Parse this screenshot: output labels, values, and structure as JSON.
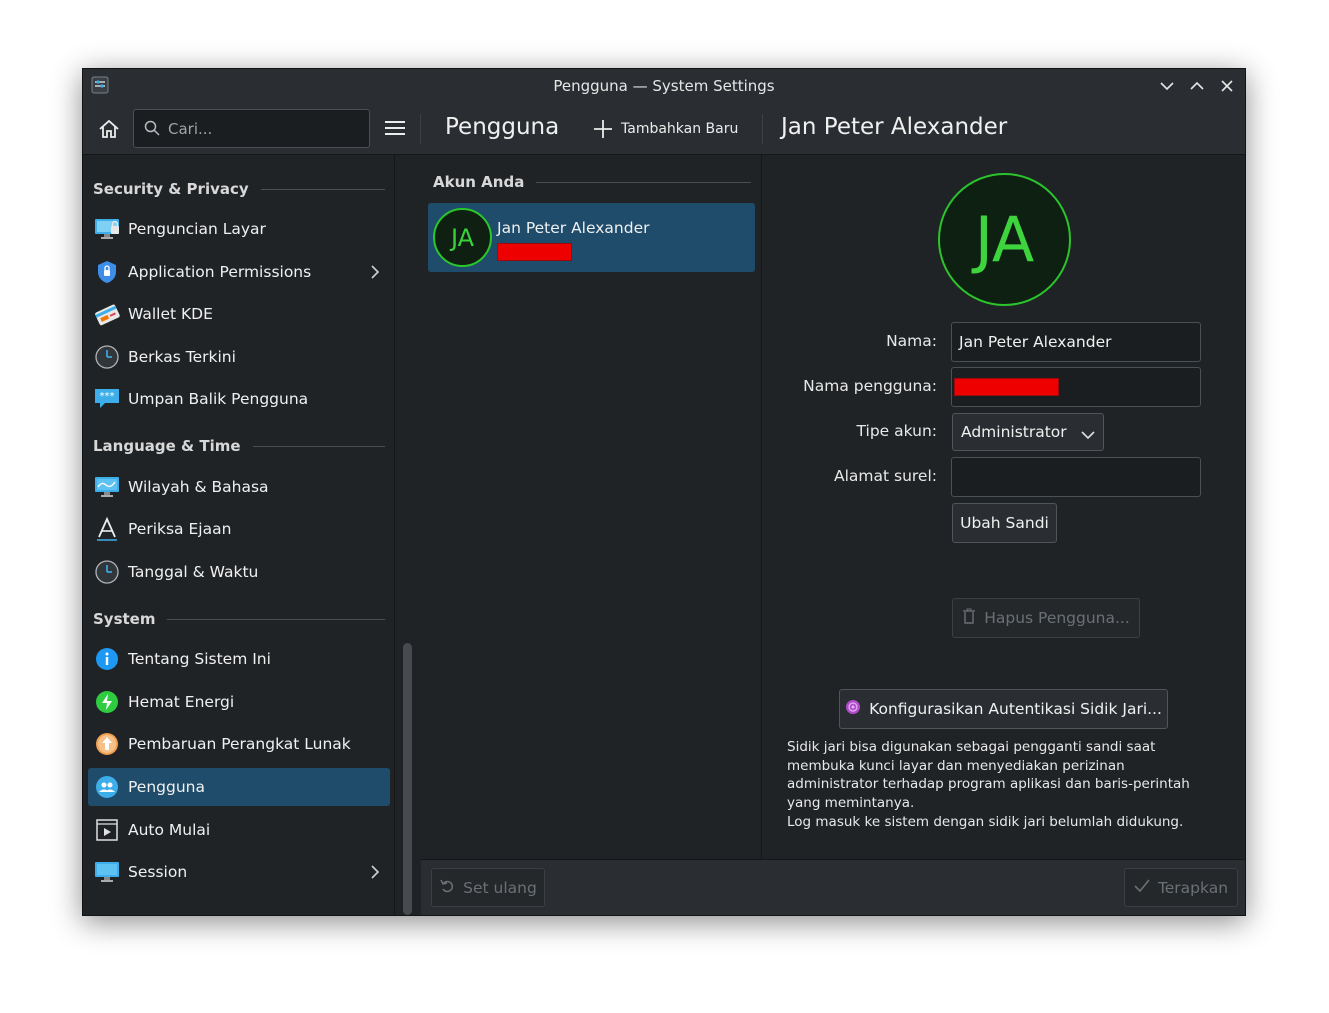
{
  "window": {
    "title": "Pengguna — System Settings"
  },
  "toolbar": {
    "search_placeholder": "Cari...",
    "page_title": "Pengguna",
    "add_new_label": "Tambahkan Baru",
    "current_user_title": "Jan Peter Alexander"
  },
  "sidebar": {
    "categories": [
      {
        "label": "Security & Privacy"
      },
      {
        "label": "Language & Time"
      },
      {
        "label": "System"
      }
    ],
    "items": [
      {
        "label": "Penguncian Layar",
        "icon": "screen-lock-icon"
      },
      {
        "label": "Application Permissions",
        "icon": "shield-icon"
      },
      {
        "label": "Wallet KDE",
        "icon": "wallet-icon"
      },
      {
        "label": "Berkas Terkini",
        "icon": "clock-icon"
      },
      {
        "label": "Umpan Balik Pengguna",
        "icon": "feedback-icon"
      },
      {
        "label": "Wilayah & Bahasa",
        "icon": "region-icon"
      },
      {
        "label": "Periksa Ejaan",
        "icon": "spellcheck-icon"
      },
      {
        "label": "Tanggal & Waktu",
        "icon": "clock-icon"
      },
      {
        "label": "Tentang Sistem Ini",
        "icon": "info-icon"
      },
      {
        "label": "Hemat Energi",
        "icon": "energy-icon"
      },
      {
        "label": "Pembaruan Perangkat Lunak",
        "icon": "update-icon"
      },
      {
        "label": "Pengguna",
        "icon": "users-icon"
      },
      {
        "label": "Auto Mulai",
        "icon": "autostart-icon"
      },
      {
        "label": "Session",
        "icon": "session-icon"
      }
    ],
    "active_item": "Pengguna"
  },
  "user_list": {
    "section_label": "Akun Anda",
    "users": [
      {
        "name": "Jan Peter Alexander",
        "initials": "JA"
      }
    ]
  },
  "details": {
    "avatar_initials": "JA",
    "name_label": "Nama:",
    "name_value": "Jan Peter Alexander",
    "username_label": "Nama pengguna:",
    "account_type_label": "Tipe akun:",
    "account_type_value": "Administrator",
    "email_label": "Alamat surel:",
    "email_value": "",
    "change_password_label": "Ubah Sandi",
    "delete_user_label": "Hapus Pengguna...",
    "fingerprint_button_label": "Konfigurasikan Autentikasi Sidik Jari...",
    "fingerprint_desc": "Sidik jari bisa digunakan sebagai pengganti sandi saat membuka kunci layar dan menyediakan perizinan administrator terhadap program aplikasi dan baris-perintah yang memintanya.",
    "fingerprint_note": "Log masuk ke sistem dengan sidik jari belumlah didukung."
  },
  "footer": {
    "reset_label": "Set ulang",
    "apply_label": "Terapkan"
  },
  "colors": {
    "accent": "#1f4c6b",
    "avatar_green": "#3dd43d",
    "window_bg": "#202326",
    "header_bg": "#2a2e32"
  }
}
